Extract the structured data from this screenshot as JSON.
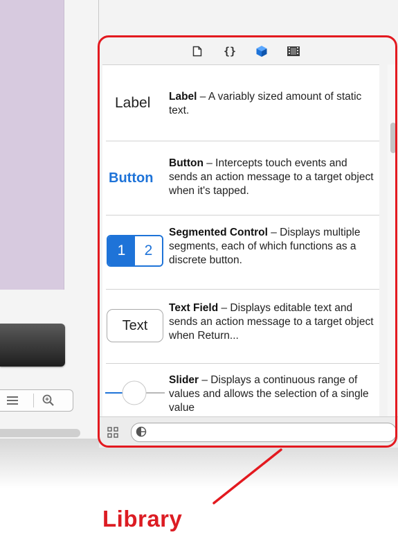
{
  "toolbar_tabs": [
    {
      "icon": "file-icon"
    },
    {
      "icon": "code-braces-icon"
    },
    {
      "icon": "object-cube-icon",
      "color": "#1e73d8"
    },
    {
      "icon": "media-film-icon"
    }
  ],
  "items": [
    {
      "name": "Label",
      "description": " – A variably sized amount of static text.",
      "preview": "Label"
    },
    {
      "name": "Button",
      "description": " – Intercepts touch events and sends an action message to a target object when it's tapped.",
      "preview": "Button"
    },
    {
      "name": "Segmented Control",
      "description": " – Displays multiple segments, each of which functions as a discrete button.",
      "preview_segments": [
        "1",
        "2"
      ]
    },
    {
      "name": "Text Field",
      "description": " – Displays editable text and sends an action message to a target object when Return...",
      "preview": "Text"
    },
    {
      "name": "Slider",
      "description": " – Displays a continuous range of values and allows the selection of a single value"
    }
  ],
  "search": {
    "placeholder": ""
  },
  "annotation": {
    "label": "Library",
    "color": "#e3191f"
  },
  "colors": {
    "accent": "#1e73d8",
    "highlight": "#e3191f"
  }
}
